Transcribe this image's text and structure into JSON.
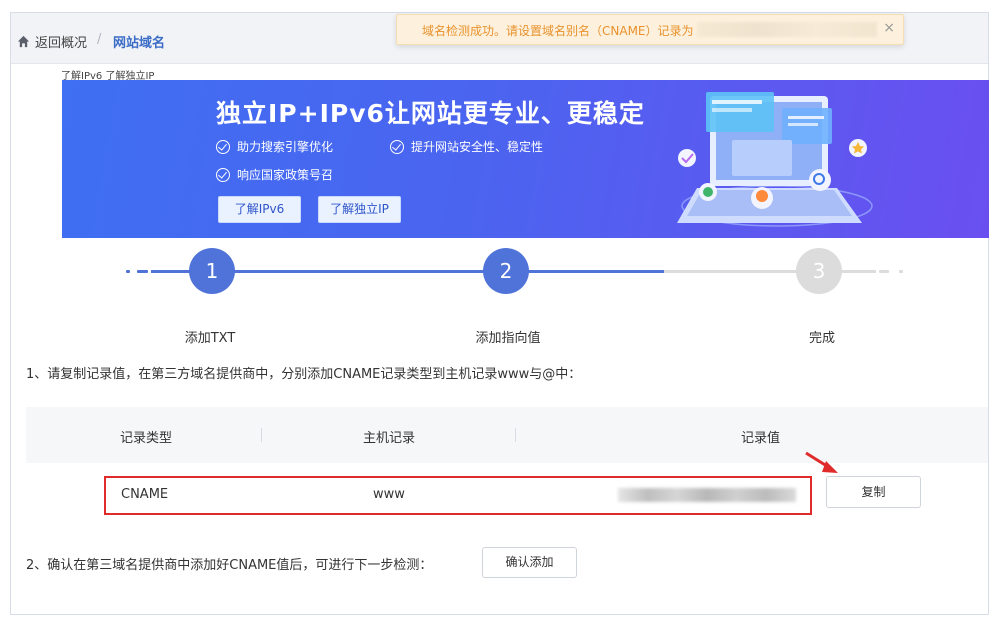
{
  "header": {
    "back_label": "返回概况",
    "separator": "/",
    "current_crumb": "网站域名"
  },
  "toast": {
    "message": "域名检测成功。请设置域名别名（CNAME）记录为",
    "close_symbol": "×"
  },
  "learn_links": "了解IPv6 了解独立IP",
  "banner": {
    "title": "独立IP+IPv6让网站更专业、更稳定",
    "features": [
      "助力搜索引擎优化",
      "提升网站安全性、稳定性",
      "响应国家政策号召"
    ],
    "button_ipv6": "了解IPv6",
    "button_ip": "了解独立IP"
  },
  "steps": [
    {
      "number": "1",
      "label": "添加TXT",
      "state": "done"
    },
    {
      "number": "2",
      "label": "添加指向值",
      "state": "active"
    },
    {
      "number": "3",
      "label": "完成",
      "state": "pending"
    }
  ],
  "instruction1": "1、请复制记录值，在第三方域名提供商中，分别添加CNAME记录类型到主机记录www与@中：",
  "table": {
    "headers": [
      "记录类型",
      "主机记录",
      "记录值"
    ],
    "row": {
      "type": "CNAME",
      "host": "www"
    },
    "copy_label": "复制"
  },
  "instruction2": "2、确认在第三域名提供商中添加好CNAME值后，可进行下一步检测：",
  "confirm_label": "确认添加",
  "colors": {
    "step_active": "#4f73d9",
    "step_pending": "#dcdcdc",
    "highlight_red": "#e02b2b",
    "link_blue": "#3b6cc6",
    "toast_text": "#e8912c"
  },
  "icons": {
    "home": "home-icon",
    "close": "close-icon",
    "check": "check-circle-icon",
    "arrow": "red-arrow-icon"
  }
}
